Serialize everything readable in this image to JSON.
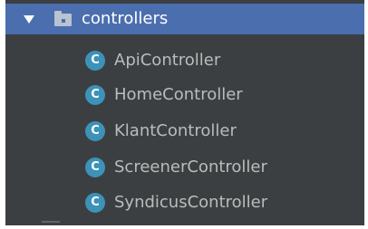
{
  "tree": {
    "folder": {
      "label": "controllers",
      "icon": "folder-icon",
      "expanded": true,
      "selected": true
    },
    "classes": [
      {
        "label": "ApiController",
        "icon_letter": "C",
        "icon": "class-icon"
      },
      {
        "label": "HomeController",
        "icon_letter": "C",
        "icon": "class-icon"
      },
      {
        "label": "KlantController",
        "icon_letter": "C",
        "icon": "class-icon"
      },
      {
        "label": "ScreenerController",
        "icon_letter": "C",
        "icon": "class-icon"
      },
      {
        "label": "SyndicusController",
        "icon_letter": "C",
        "icon": "class-icon"
      }
    ]
  },
  "colors": {
    "panel_background": "#3c3f41",
    "selection_background": "#4b6eaf",
    "text": "#bbbbbb",
    "selected_text": "#ffffff",
    "class_icon": "#3d92b8"
  }
}
